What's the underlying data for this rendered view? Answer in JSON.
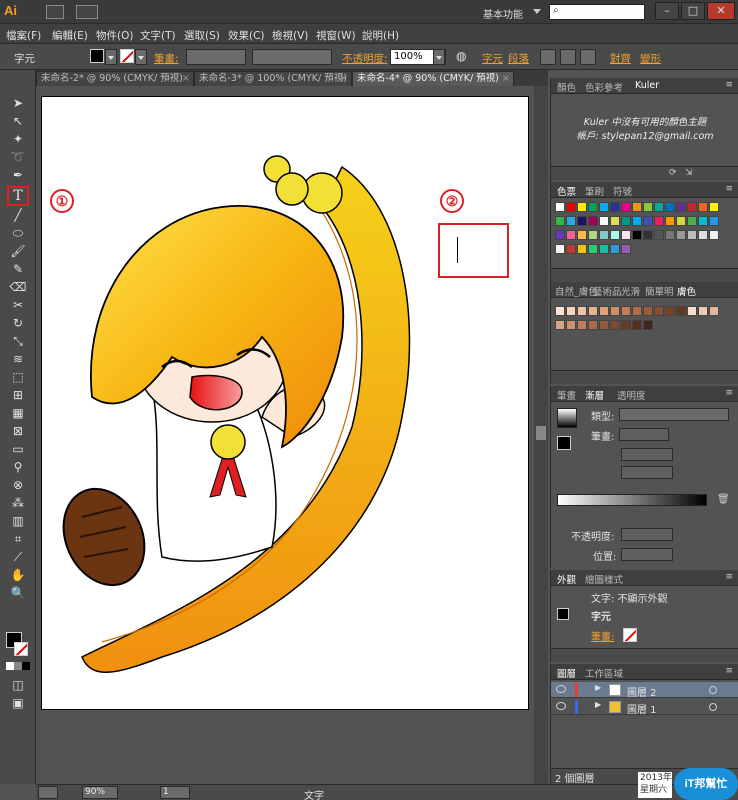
{
  "titlebar": {
    "app_logo": "Ai",
    "workspace": "基本功能",
    "window_controls": [
      "–",
      "□",
      "✕"
    ]
  },
  "menu": [
    "檔案(F)",
    "編輯(E)",
    "物件(O)",
    "文字(T)",
    "選取(S)",
    "效果(C)",
    "檢視(V)",
    "視窗(W)",
    "說明(H)"
  ],
  "control_bar": {
    "mode_label": "字元",
    "stroke_label": "筆畫:",
    "opacity_label": "不透明度:",
    "opacity_value": "100%",
    "char_link": "字元",
    "para_link": "段落",
    "align_link": "對齊",
    "transform_link": "變形"
  },
  "tabs": [
    {
      "label": "未命名-2* @ 90% (CMYK/ 預視)",
      "close": "×"
    },
    {
      "label": "未命名-3* @ 100% (CMYK/ 預視)",
      "close": "×"
    },
    {
      "label": "未命名-4* @ 90% (CMYK/ 預視)",
      "close": "×"
    }
  ],
  "canvas": {
    "marker1": "①",
    "marker2": "②"
  },
  "status_bar": {
    "zoom": "90%",
    "page": "1",
    "tool": "文字"
  },
  "panels": {
    "color_tabs": [
      "顏色",
      "色彩參考",
      "Kuler"
    ],
    "kuler_message_line1": "Kuler 中沒有可用的顏色主題",
    "kuler_message_line2": "帳戶: stylepan12@gmail.com",
    "swatch_tabs": [
      "色票",
      "筆刷",
      "符號"
    ],
    "library_tabs": [
      "自然_膚色",
      "藝術品",
      "光滑",
      "簡單明",
      "膚色"
    ],
    "gradient_tabs": [
      "筆畫",
      "漸層",
      "透明度"
    ],
    "gradient": {
      "type_label": "類型:",
      "stroke_label": "筆畫:",
      "opacity_label": "不透明度:",
      "position_label": "位置:"
    },
    "appearance_tabs": [
      "外觀",
      "繪圖樣式"
    ],
    "appearance": {
      "title": "文字: 不顯示外觀",
      "char_label": "字元",
      "stroke_label": "筆畫:"
    },
    "layers_tabs": [
      "圖層",
      "工作區域"
    ],
    "layers": [
      {
        "name": "圖層 2",
        "color": "#e83a3a",
        "selected": true
      },
      {
        "name": "圖層 1",
        "color": "#3a6ae8",
        "selected": false
      }
    ],
    "layers_count": "2 個圖層"
  },
  "colors": {
    "accent": "#f0a030",
    "highlight_red": "#e02020"
  },
  "watermark": {
    "line1": "2013年",
    "line2": "星期六",
    "brand": "iT邦幫忙"
  }
}
